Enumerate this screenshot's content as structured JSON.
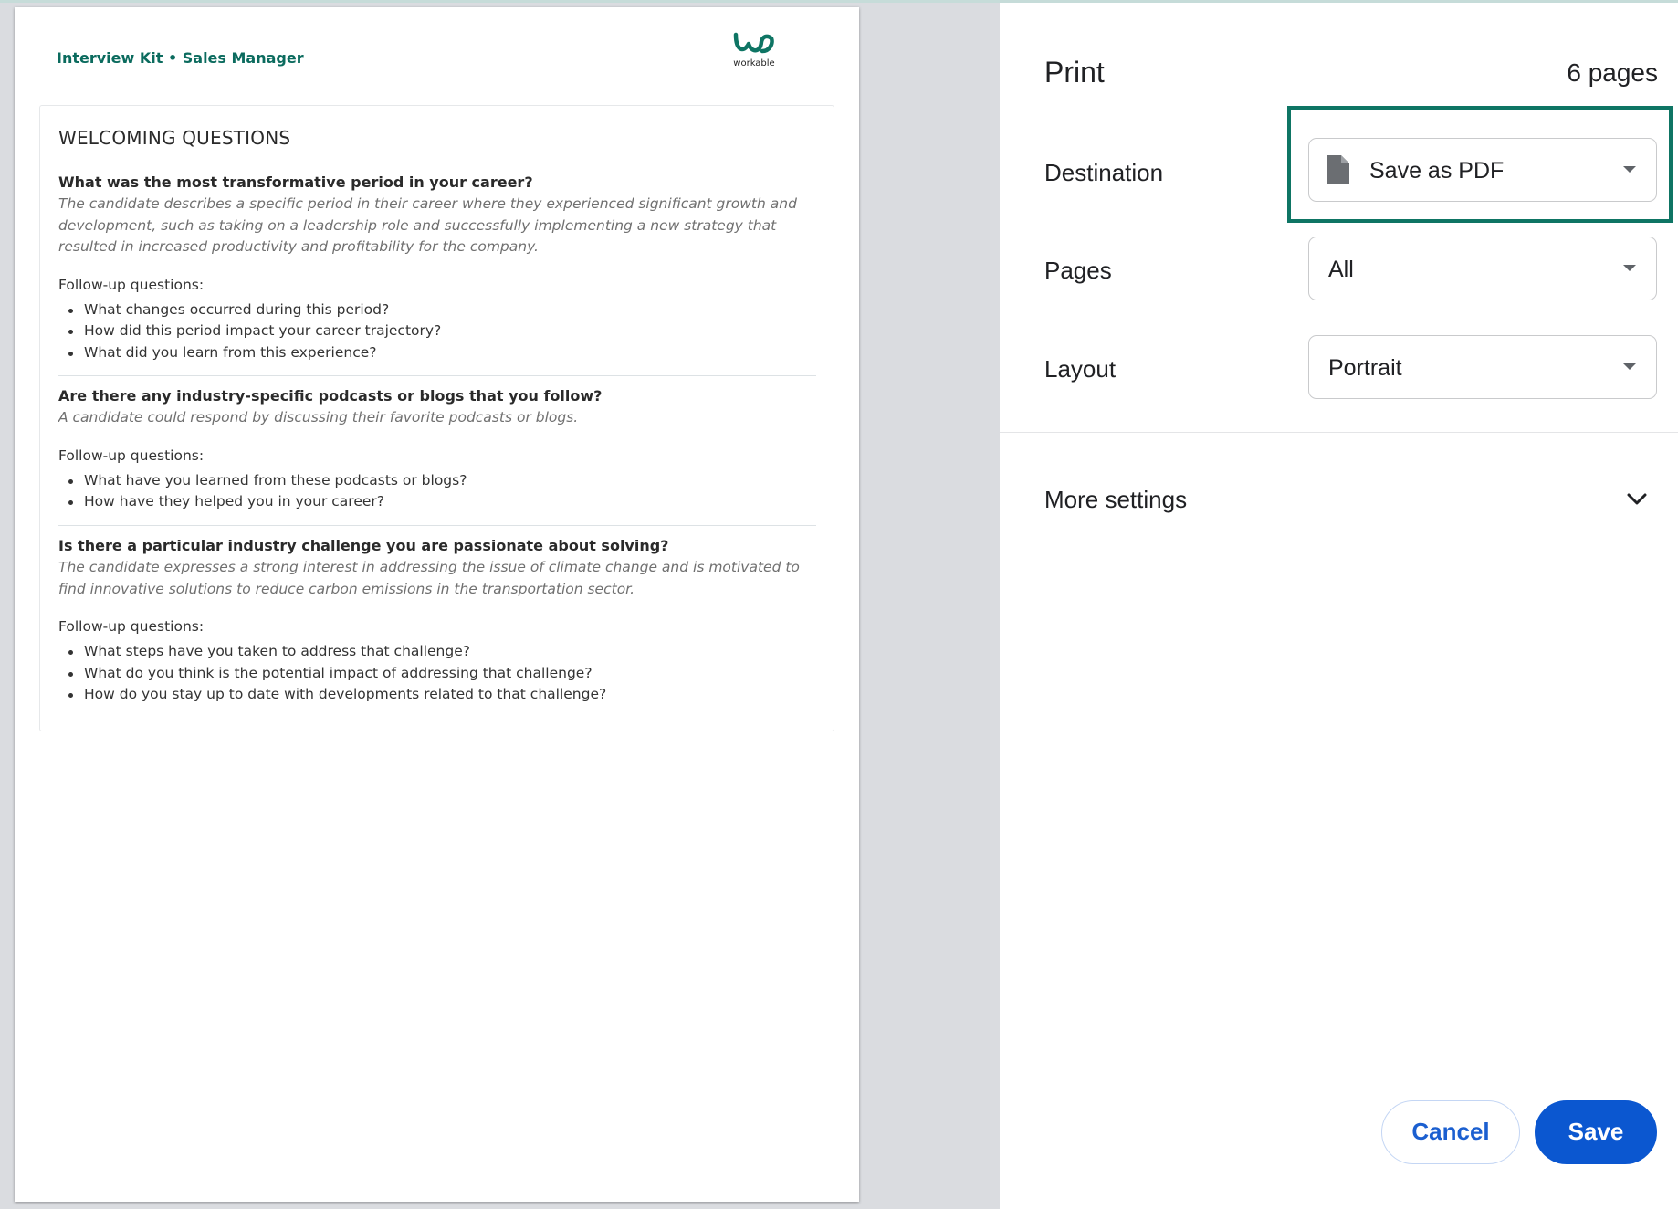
{
  "document": {
    "header": "Interview Kit • Sales Manager",
    "logo_text": "workable",
    "section_title": "WELCOMING QUESTIONS",
    "questions": [
      {
        "question": "What was the most transformative period in your career?",
        "description": "The candidate describes a specific period in their career where they experienced significant growth and development, such as taking on a leadership role and successfully implementing a new strategy that resulted in increased productivity and profitability for the company.",
        "followup_label": "Follow-up questions:",
        "followups": [
          "What changes occurred during this period?",
          "How did this period impact your career trajectory?",
          "What did you learn from this experience?"
        ]
      },
      {
        "question": "Are there any industry-specific podcasts or blogs that you follow?",
        "description": "A candidate could respond by discussing their favorite podcasts or blogs.",
        "followup_label": "Follow-up questions:",
        "followups": [
          "What have you learned from these podcasts or blogs?",
          "How have they helped you in your career?"
        ]
      },
      {
        "question": "Is there a particular industry challenge you are passionate about solving?",
        "description": "The candidate expresses a strong interest in addressing the issue of climate change and is motivated to find innovative solutions to reduce carbon emissions in the transportation sector.",
        "followup_label": "Follow-up questions:",
        "followups": [
          "What steps have you taken to address that challenge?",
          "What do you think is the potential impact of addressing that challenge?",
          "How do you stay up to date with developments related to that challenge?"
        ]
      }
    ]
  },
  "print": {
    "title": "Print",
    "page_count": "6 pages",
    "destination": {
      "label": "Destination",
      "value": "Save as PDF",
      "icon": "file-icon"
    },
    "pages": {
      "label": "Pages",
      "value": "All"
    },
    "layout": {
      "label": "Layout",
      "value": "Portrait"
    },
    "more_settings": "More settings",
    "cancel": "Cancel",
    "save": "Save"
  },
  "colors": {
    "brand_green": "#0e7564",
    "save_blue": "#0b57d0",
    "cancel_text": "#1b5fd0"
  }
}
